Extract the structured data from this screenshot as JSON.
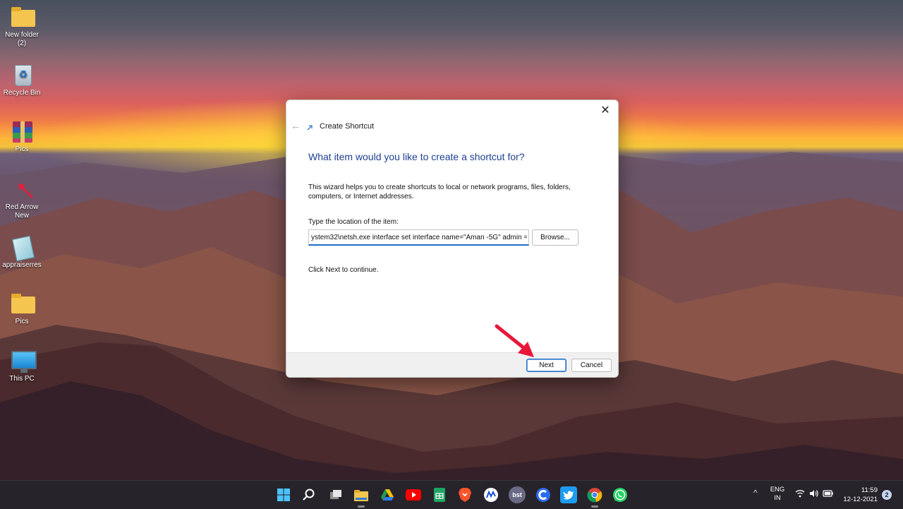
{
  "desktop": {
    "icons": [
      {
        "label": "New folder (2)",
        "icon": "folder-icon"
      },
      {
        "label": "Recycle Bin",
        "icon": "recycle-bin-icon"
      },
      {
        "label": "Pics",
        "icon": "winrar-icon"
      },
      {
        "label": "Red Arrow New",
        "icon": "red-arrow-icon"
      },
      {
        "label": "appraiserres",
        "icon": "document-icon"
      },
      {
        "label": "Pics",
        "icon": "folder-icon"
      },
      {
        "label": "This PC",
        "icon": "monitor-icon"
      }
    ]
  },
  "dialog": {
    "title": "Create Shortcut",
    "close_glyph": "✕",
    "back_glyph": "←",
    "heading": "What item would you like to create a shortcut for?",
    "intro": "This wizard helps you to create shortcuts to local or network programs, files, folders, computers, or Internet addresses.",
    "location_label": "Type the location of the item:",
    "location_value": "ystem32\\netsh.exe interface set interface name=\"Aman -5G\" admin =",
    "browse_label": "Browse...",
    "continue_text": "Click Next to continue.",
    "next_label": "Next",
    "cancel_label": "Cancel"
  },
  "taskbar": {
    "apps": [
      "start-icon",
      "search-icon",
      "task-view-icon",
      "file-explorer-icon",
      "google-drive-icon",
      "youtube-icon",
      "google-sheets-icon",
      "brave-icon",
      "coinmarketcap-icon",
      "bst-icon",
      "ccleaner-icon",
      "twitter-icon",
      "chrome-icon",
      "whatsapp-icon"
    ],
    "bst_label": "bst",
    "tray": {
      "chevron": "^",
      "lang_line1": "ENG",
      "lang_line2": "IN",
      "time": "11:59",
      "date": "12-12-2021",
      "notification_count": "2"
    }
  },
  "colors": {
    "accent": "#1f6fc5",
    "heading": "#1e3f8f",
    "taskbar": "#27232a",
    "pointer_arrow": "#e8173a"
  }
}
